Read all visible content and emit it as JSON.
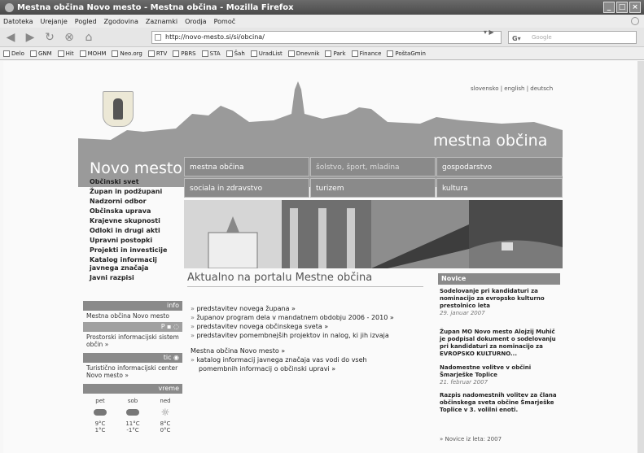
{
  "window": {
    "title": "Mestna občina Novo mesto - Mestna občina - Mozilla Firefox"
  },
  "menu": [
    "Datoteka",
    "Urejanje",
    "Pogled",
    "Zgodovina",
    "Zaznamki",
    "Orodja",
    "Pomoč"
  ],
  "nav": {
    "url": "http://novo-mesto.si/si/obcina/",
    "search_placeholder": "Google"
  },
  "bookmarks": [
    "Delo",
    "GNM",
    "Hit",
    "MOHM",
    "Neo.org",
    "RTV",
    "PBRS",
    "STA",
    "Šah",
    "UradList",
    "Dnevnik",
    "Park",
    "Finance",
    "PoštaGmin"
  ],
  "site": {
    "languages": "slovensko | english | deutsch",
    "header_title": "mestna občina",
    "city_name": "Novo mesto",
    "tabs": [
      "mestna občina",
      "šolstvo, šport, mladina",
      "gospodarstvo",
      "sociala in zdravstvo",
      "turizem",
      "kultura"
    ],
    "left_nav": [
      "Občinski svet",
      "Župan in podžupani",
      "Nadzorni odbor",
      "Občinska uprava",
      "Krajevne skupnosti",
      "Odloki in drugi akti",
      "Upravni postopki",
      "Projekti in investicije",
      "Katalog informacij javnega značaja",
      "Javni razpisi"
    ],
    "info": {
      "head": "info",
      "text": "Mestna občina Novo mesto"
    },
    "pisoc": {
      "text": "Prostorski informacijski sistem občin »"
    },
    "tic": {
      "head": "tic",
      "text": "Turistično informacijski center Novo mesto »"
    },
    "weather": {
      "head": "vreme",
      "days": [
        {
          "day": "pet",
          "t1": "9°C",
          "t2": "1°C"
        },
        {
          "day": "sob",
          "t1": "11°C",
          "t2": "-1°C"
        },
        {
          "day": "ned",
          "t1": "8°C",
          "t2": "0°C"
        }
      ]
    },
    "portal_title": "Aktualno na portalu Mestne občina",
    "bullets": [
      "predstavitev novega župana »",
      "županov program dela v mandatnem obdobju 2006 - 2010 »",
      "predstavitev novega občinskega sveta »",
      "predstavitev pomembnejših projektov in nalog, ki jih izvaja",
      "Mestna občina Novo mesto »",
      "katalog informacij javnega značaja vas vodi do vseh",
      "pomembnih informacij o občinski upravi »"
    ],
    "news_head": "Novice",
    "news": [
      {
        "title": "Sodelovanje pri kandidaturi za nominacijo za evropsko kulturno prestolnico leta",
        "date": "29. januar 2007"
      },
      {
        "title": "Župan MO Novo mesto Alojzij Muhič je podpisal dokument o sodelovanju pri kandidaturi za nominacijo za EVROPSKO KULTURNO...",
        "date": ""
      },
      {
        "title": "Nadomestne volitve v občini Šmarješke Toplice",
        "date": "21. februar 2007"
      },
      {
        "title": "Razpis nadomestnih volitev za člana občinskega sveta občine Šmarješke Toplice v 3. volilni enoti.",
        "date": ""
      }
    ],
    "news_more": "» Novice iz leta: 2007"
  }
}
